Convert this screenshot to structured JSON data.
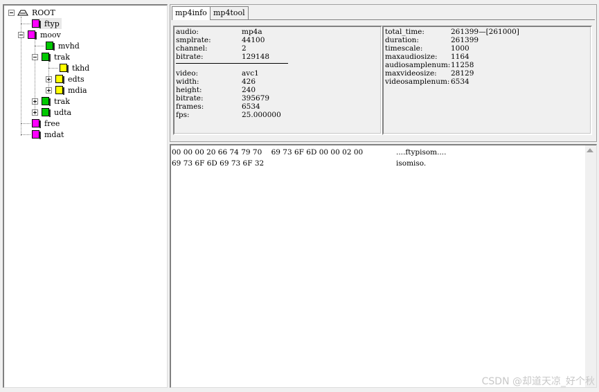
{
  "tree": {
    "root": "ROOT",
    "nodes": [
      {
        "label": "ftyp"
      },
      {
        "label": "moov"
      },
      {
        "label": "mvhd"
      },
      {
        "label": "trak"
      },
      {
        "label": "tkhd"
      },
      {
        "label": "edts"
      },
      {
        "label": "mdia"
      },
      {
        "label": "trak"
      },
      {
        "label": "udta"
      },
      {
        "label": "free"
      },
      {
        "label": "mdat"
      }
    ]
  },
  "tabs": [
    {
      "label": "mp4info"
    },
    {
      "label": "mp4tool"
    }
  ],
  "audio_info": [
    {
      "key": "audio:",
      "value": "mp4a"
    },
    {
      "key": "smplrate:",
      "value": "44100"
    },
    {
      "key": "channel:",
      "value": "2"
    },
    {
      "key": "bitrate:",
      "value": "129148"
    }
  ],
  "video_info": [
    {
      "key": "video:",
      "value": "avc1"
    },
    {
      "key": "width:",
      "value": "426"
    },
    {
      "key": "height:",
      "value": "240"
    },
    {
      "key": "bitrate:",
      "value": "395679"
    },
    {
      "key": "frames:",
      "value": "6534"
    },
    {
      "key": "fps:",
      "value": "25.000000"
    }
  ],
  "stats_info": [
    {
      "key": "total_time:",
      "value": "261399—[261000]"
    },
    {
      "key": "duration:",
      "value": "261399"
    },
    {
      "key": "timescale:",
      "value": "1000"
    },
    {
      "key": "maxaudiosize:",
      "value": "1164"
    },
    {
      "key": "audiosamplenum:",
      "value": "11258"
    },
    {
      "key": "maxvideosize:",
      "value": "28129"
    },
    {
      "key": "videosamplenum:",
      "value": "6534"
    }
  ],
  "hex": [
    {
      "bytes": "00 00 00 20 66 74 79 70    69 73 6F 6D 00 00 02 00",
      "ascii": "....ftypisom...."
    },
    {
      "bytes": "69 73 6F 6D 69 73 6F 32",
      "ascii": "isomiso."
    }
  ],
  "watermark": "CSDN @却道天凉_好个秋",
  "colors": {
    "atom_leaf": "#ff00ff",
    "atom_container": "#00c800",
    "atom_sub": "#ffff00"
  }
}
